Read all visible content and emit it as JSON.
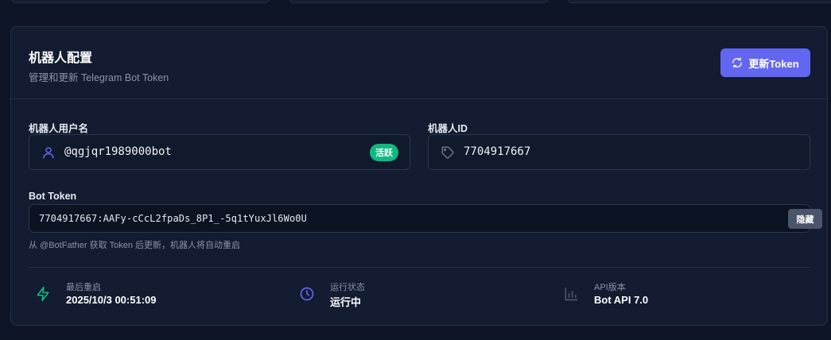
{
  "panel": {
    "title": "机器人配置",
    "subtitle": "管理和更新 Telegram Bot Token",
    "refresh_button_label": "更新Token"
  },
  "username_field": {
    "label": "机器人用户名",
    "value": "@qgjqr1989000bot",
    "badge": "活跃",
    "icon": "user-icon"
  },
  "id_field": {
    "label": "机器人ID",
    "value": "7704917667",
    "icon": "tag-icon"
  },
  "token_field": {
    "label": "Bot Token",
    "value": "7704917667:AAFy-cCcL2fpaDs_8P1_-5q1tYuxJl6Wo0U",
    "hide_button_label": "隐藏",
    "hint": "从 @BotFather 获取 Token 后更新，机器人将自动重启"
  },
  "stats": [
    {
      "label": "最后重启",
      "value": "2025/10/3 00:51:09",
      "icon": "bolt-icon",
      "color": "#10b981"
    },
    {
      "label": "运行状态",
      "value": "运行中",
      "icon": "clock-icon",
      "color": "#6366f1"
    },
    {
      "label": "API版本",
      "value": "Bot API 7.0",
      "icon": "bar-chart-icon",
      "color": "#4b5569"
    }
  ],
  "colors": {
    "accent": "#6366f1",
    "success": "#10b981",
    "background": "#0e1526",
    "panel": "#131c30"
  }
}
